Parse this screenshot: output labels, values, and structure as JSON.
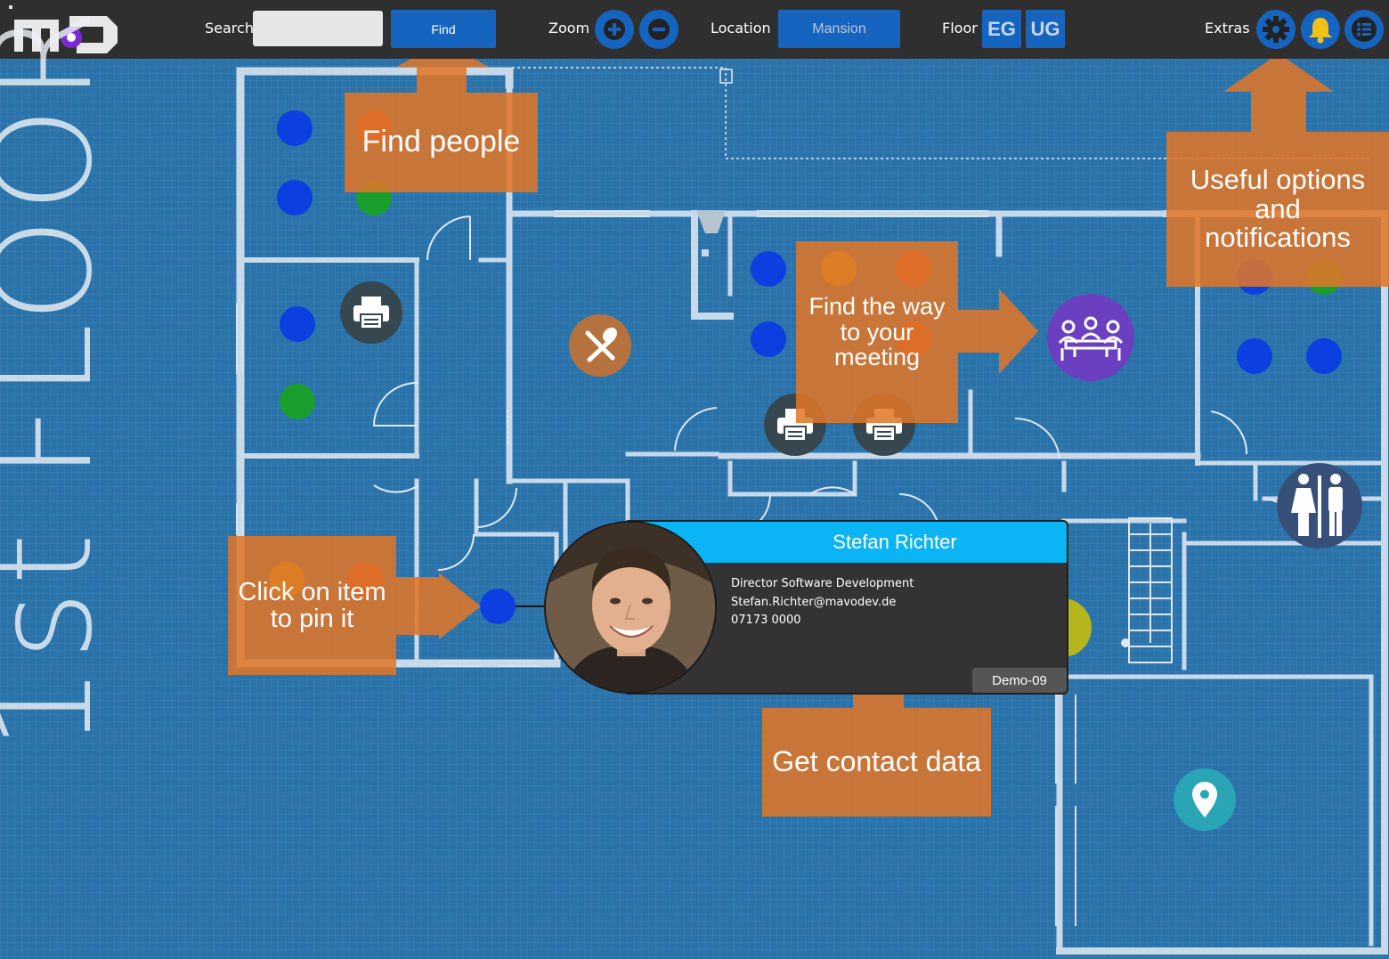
{
  "toolbar": {
    "logo_text": "MD",
    "search_label": "Search",
    "search_value": "",
    "find_label": "Find",
    "zoom_label": "Zoom",
    "zoom_in_icon": "plus-icon",
    "zoom_out_icon": "minus-icon",
    "location_label": "Location",
    "location_value": "Mansion",
    "floor_label": "Floor",
    "floor_eg": "EG",
    "floor_ug": "UG",
    "extras_label": "Extras",
    "extras_icons": [
      "gear-icon",
      "bell-icon",
      "list-icon"
    ]
  },
  "map": {
    "floor_title": "1st FLOOR",
    "icons": [
      "printer-icon",
      "cutlery-icon",
      "meeting-icon",
      "restroom-icon",
      "location-pin-icon",
      "lock-icon"
    ]
  },
  "callouts": {
    "find_people": "Find people",
    "useful_options": "Useful options and notifications",
    "find_way": "Find the way to your meeting",
    "click_pin": "Click on item to pin it",
    "contact_data": "Get contact data"
  },
  "contact_card": {
    "name": "Stefan Richter",
    "title": "Director Software Development",
    "email": "Stefan.Richter@mavodev.de",
    "phone": "07173 0000",
    "room": "Demo-09"
  },
  "colors": {
    "toolbar_bg": "#2f2f2f",
    "map_bg": "#2a73aa",
    "button_blue": "#1565c0",
    "callout_orange": "#e27626",
    "card_header": "#0ab4f5",
    "meeting_purple": "#6a3fc0",
    "pin_teal": "#2aa5b5"
  }
}
